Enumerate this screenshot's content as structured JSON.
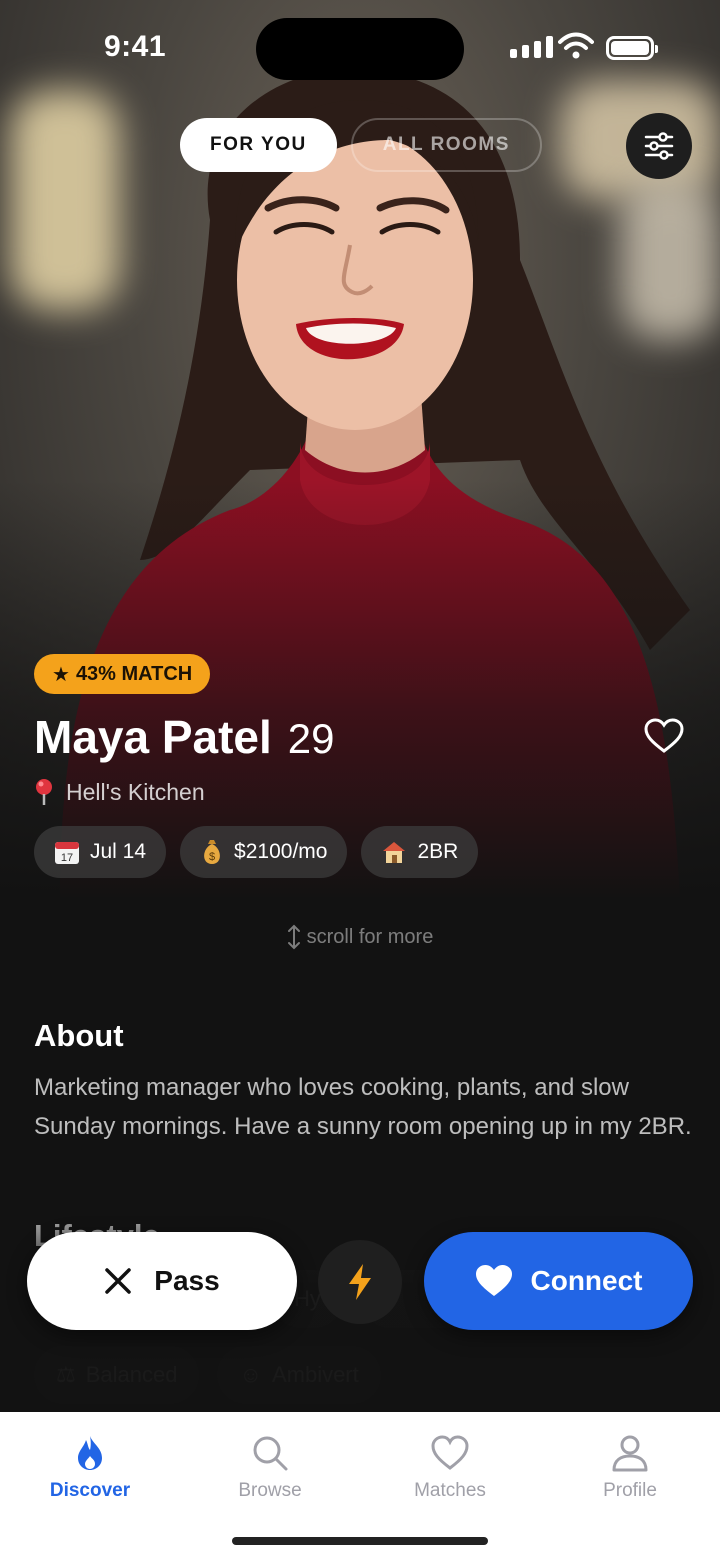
{
  "status": {
    "time": "9:41"
  },
  "tabs": [
    {
      "label": "FOR YOU",
      "active": true
    },
    {
      "label": "ALL ROOMS",
      "active": false
    }
  ],
  "profile": {
    "match": "43% MATCH",
    "name": "Maya Patel",
    "age": "29",
    "location": "Hell's Kitchen",
    "chips": [
      {
        "icon": "calendar-icon",
        "label": "Jul 14"
      },
      {
        "icon": "money-bag-icon",
        "label": "$2100/mo"
      },
      {
        "icon": "house-icon",
        "label": "2BR"
      }
    ]
  },
  "scroll_hint": "scroll for more",
  "about": {
    "title": "About",
    "text": "Marketing manager who loves cooking, plants, and slow Sunday mornings. Have a sunny room opening up in my 2BR."
  },
  "lifestyle": {
    "title": "Lifestyle",
    "row1": [
      "",
      "Hy",
      ""
    ],
    "row2": [
      "Balanced",
      "Ambivert"
    ]
  },
  "actions": {
    "pass": "Pass",
    "connect": "Connect"
  },
  "tabbar": [
    {
      "label": "Discover",
      "icon": "flame-icon",
      "active": true
    },
    {
      "label": "Browse",
      "icon": "search-icon",
      "active": false
    },
    {
      "label": "Matches",
      "icon": "heart-icon",
      "active": false
    },
    {
      "label": "Profile",
      "icon": "person-icon",
      "active": false
    }
  ],
  "colors": {
    "accent": "#2265e5",
    "badge": "#f4a21b",
    "background": "#121212"
  }
}
